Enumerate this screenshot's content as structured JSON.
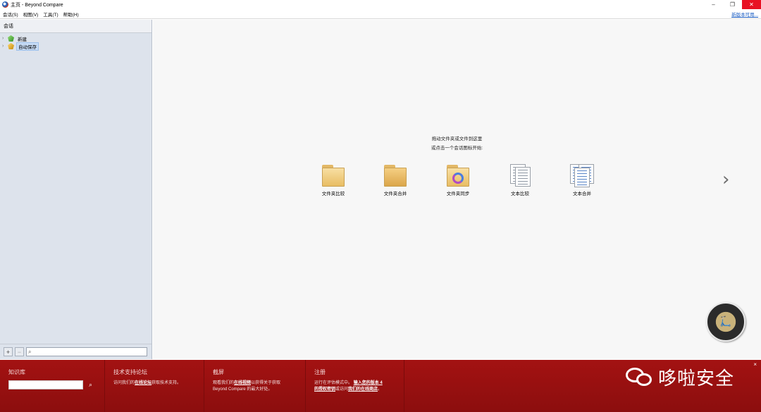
{
  "window": {
    "title": "主页 - Beyond Compare",
    "buttons": [
      "minimize",
      "restore",
      "close"
    ]
  },
  "menubar": {
    "items": [
      "会话(S)",
      "视图(V)",
      "工具(T)",
      "帮助(H)"
    ],
    "new_version": "新版本可用..."
  },
  "sidebar": {
    "header": "会话",
    "items": [
      {
        "label": "新建",
        "icon": "green-gem-icon",
        "selected": false
      },
      {
        "label": "自动保存",
        "icon": "gold-gem-icon",
        "selected": true
      }
    ],
    "add_button": "+",
    "remove_button": "−",
    "filter_icon": "⌕"
  },
  "main": {
    "hint_line1": "拖动文件夹或文件到这里",
    "hint_line2": "或点击一个会话图标开始:",
    "sessions": [
      {
        "label": "文件夹比较",
        "icon": "folder-compare-icon"
      },
      {
        "label": "文件夹合并",
        "icon": "folder-merge-icon"
      },
      {
        "label": "文件夹同步",
        "icon": "folder-sync-icon"
      },
      {
        "label": "文本比较",
        "icon": "text-compare-icon"
      },
      {
        "label": "文本合并",
        "icon": "text-merge-icon"
      }
    ],
    "next_arrow": "›"
  },
  "footer": {
    "colors": {
      "background": "#9a1010"
    },
    "kb": {
      "title": "知识库",
      "search_icon": "⌕"
    },
    "forum": {
      "title": "技术支持论坛",
      "pre": "访问我们的",
      "link": "在线论坛",
      "post": "获取技术支持。"
    },
    "screenshots": {
      "title": "截屏",
      "pre": "观看我们的",
      "link": "在线视频",
      "post": "以获得关于获取",
      "line2": "Beyond Compare 的最大好处。"
    },
    "register": {
      "title": "注册",
      "pre": "运行在评估模式中。",
      "link1": "输入您的版本 4",
      "link1b": "的授权密钥",
      "mid": "或访问",
      "link2": "我们的在线商店",
      "post": "。"
    },
    "close": "×"
  },
  "watermark": {
    "text": "哆啦安全"
  }
}
